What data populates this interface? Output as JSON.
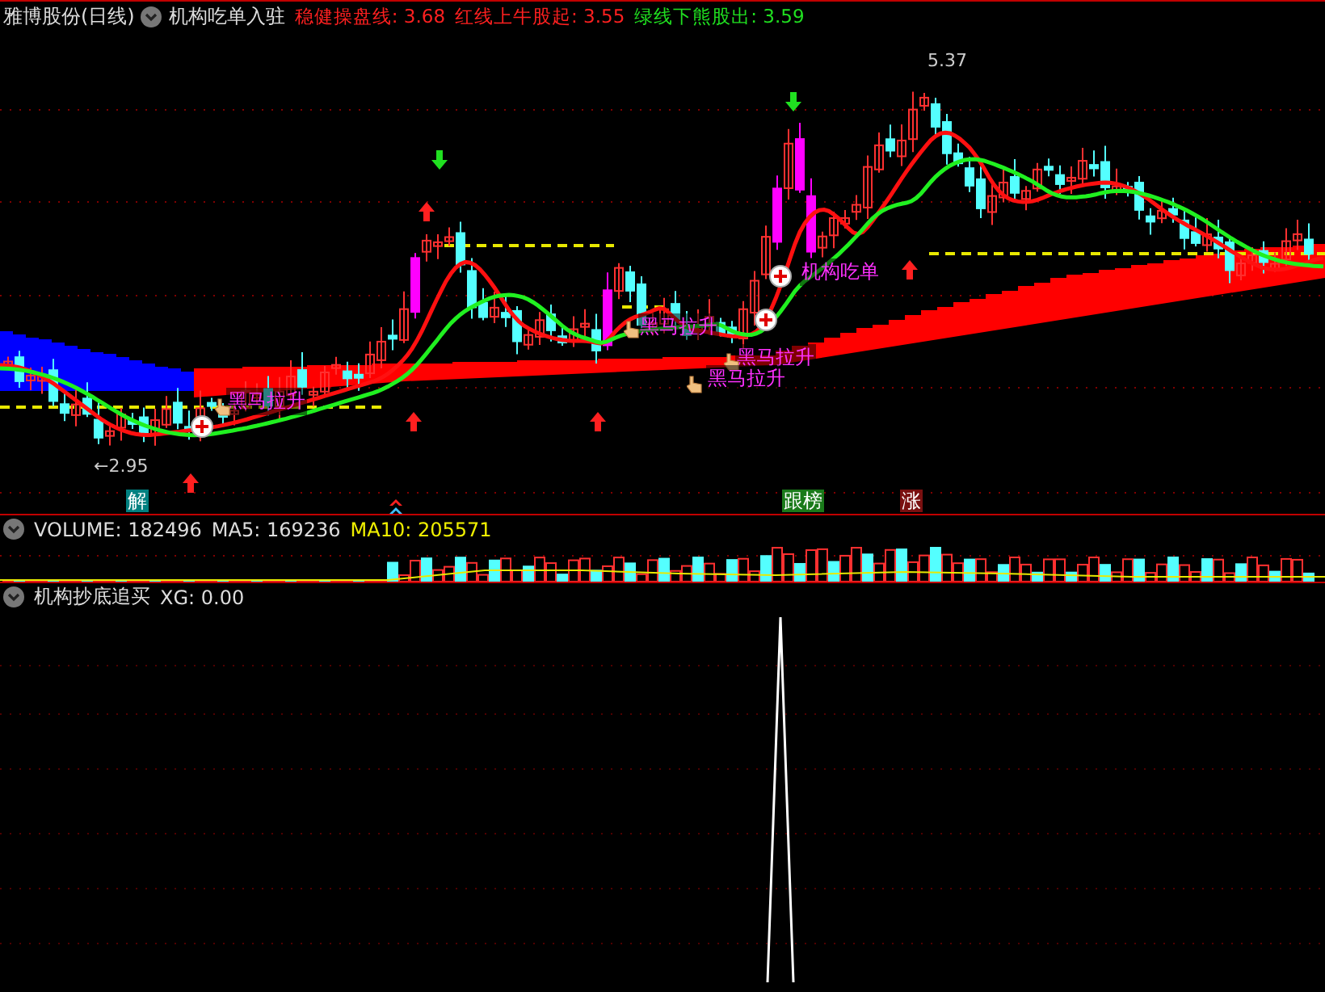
{
  "header": {
    "stock": "雅博股份(日线)",
    "indicator": "机构吃单入驻",
    "lines": [
      {
        "label": "稳健操盘线: 3.68",
        "color": "#ff2020"
      },
      {
        "label": "红线上牛股起: 3.55",
        "color": "#ff2020"
      },
      {
        "label": "绿线下熊股出: 3.59",
        "color": "#20e020"
      }
    ]
  },
  "main_chart": {
    "extremes": [
      {
        "kind": "low",
        "text": "←2.95"
      },
      {
        "kind": "high",
        "text": "5.37"
      }
    ],
    "signals": [
      {
        "kind": "hand",
        "text": "黑马拉升"
      },
      {
        "kind": "hand",
        "text": "黑马拉升"
      },
      {
        "kind": "plus",
        "text": "机构吃单"
      },
      {
        "kind": "hand",
        "text": "黑马拉升"
      },
      {
        "kind": "hand",
        "text": "黑马拉升"
      }
    ],
    "markers": [
      {
        "text": "解",
        "color": "#008080"
      },
      {
        "text": "跟榜",
        "color": "#1a7a1a"
      },
      {
        "text": "涨",
        "color": "#7a1010"
      }
    ]
  },
  "volume": {
    "title": "VOLUME: 182496",
    "ma5": "MA5: 169236",
    "ma10": "MA10: 205571"
  },
  "indicator": {
    "title": "机构抄底追买",
    "xg": "XG: 0.00"
  }
}
